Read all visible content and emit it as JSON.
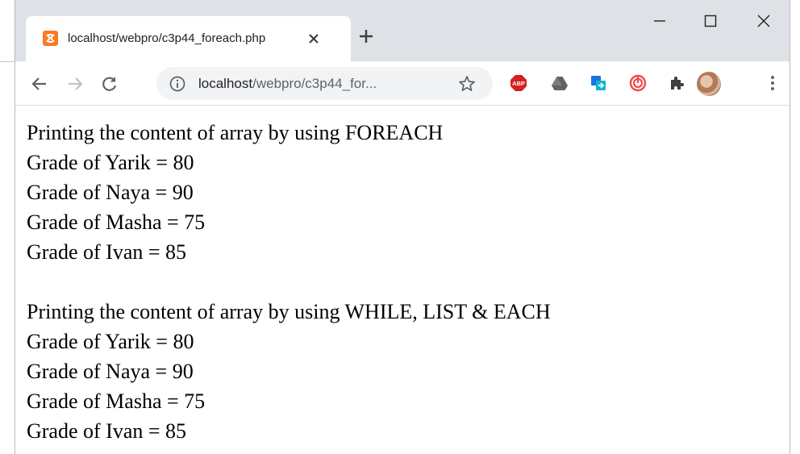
{
  "browser": {
    "tab_title": "localhost/webpro/c3p44_foreach.php",
    "new_tab_label": "+",
    "address_host": "localhost",
    "address_path": "/webpro/c3p44_for...",
    "extensions": [
      "adblock-plus",
      "google-drive",
      "cast",
      "spiral-extension",
      "extensions-puzzle"
    ],
    "abp_label": "ABP"
  },
  "page": {
    "section1": {
      "heading": "Printing the content of array by using FOREACH",
      "lines": [
        "Grade of Yarik = 80",
        "Grade of Naya = 90",
        "Grade of Masha = 75",
        "Grade of Ivan = 85"
      ]
    },
    "section2": {
      "heading": "Printing the content of array by using WHILE, LIST & EACH",
      "lines": [
        "Grade of Yarik = 80",
        "Grade of Naya = 90",
        "Grade of Masha = 75",
        "Grade of Ivan = 85"
      ]
    }
  },
  "colors": {
    "tabstrip": "#dee1e6",
    "favicon": "#fb7a24",
    "abp": "#d61f1f",
    "spiral": "#f04a4a"
  }
}
